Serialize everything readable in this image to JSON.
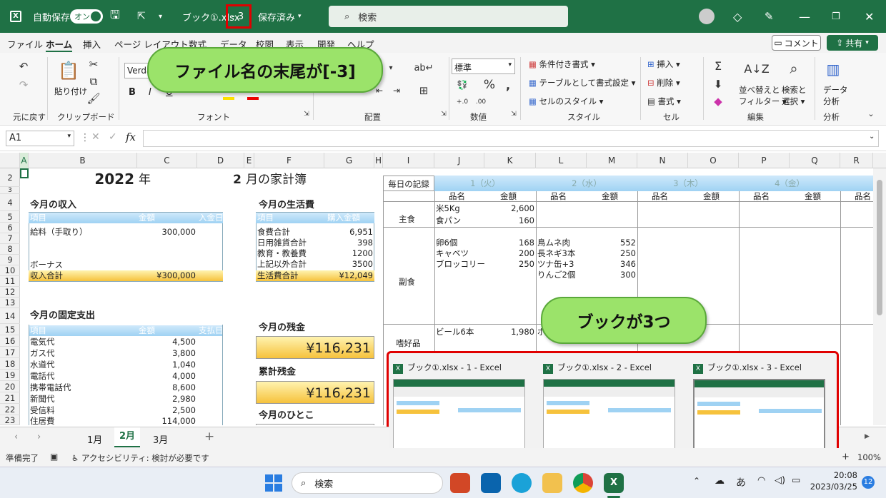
{
  "titlebar": {
    "autosave_label": "自動保存",
    "autosave_state": "オン",
    "filename": "ブック①.xlsx",
    "suffix": "- 3",
    "save_state": "保存済み",
    "search_placeholder": "検索"
  },
  "menu": [
    "ファイル",
    "ホーム",
    "挿入",
    "ページ レイアウト",
    "数式",
    "データ",
    "校閲",
    "表示",
    "開発",
    "ヘルプ"
  ],
  "menu_right": {
    "comment": "コメント",
    "share": "共有"
  },
  "ribbon": {
    "undo_label": "元に戻す",
    "paste_label": "貼り付け",
    "clipboard_label": "クリップボード",
    "font_name": "Verda",
    "font_label": "フォント",
    "align_label": "配置",
    "number_format": "標準",
    "number_label": "数値",
    "style_items": [
      "条件付き書式",
      "テーブルとして書式設定",
      "セルのスタイル"
    ],
    "style_label": "スタイル",
    "cell_items": [
      "挿入",
      "削除",
      "書式"
    ],
    "cell_label": "セル",
    "edit_sort": "並べ替えと",
    "edit_filter": "フィルター",
    "edit_find": "検索と",
    "edit_select": "選択",
    "edit_label": "編集",
    "analysis_text1": "データ",
    "analysis_text2": "分析",
    "analysis_label": "分析"
  },
  "formula": {
    "namebox": "A1",
    "fx": "fx"
  },
  "columns": [
    "A",
    "B",
    "C",
    "D",
    "E",
    "F",
    "G",
    "H",
    "I",
    "J",
    "K",
    "L",
    "M",
    "N",
    "O",
    "P",
    "Q",
    "R"
  ],
  "rows": [
    "2",
    "3",
    "4",
    "5",
    "6",
    "7",
    "8",
    "9",
    "10",
    "11",
    "12",
    "13",
    "14",
    "15",
    "16",
    "17",
    "18",
    "19",
    "20",
    "21",
    "22",
    "23"
  ],
  "sheet": {
    "year": "2022",
    "year_unit": "年",
    "month": "2",
    "month_title": "月の家計簿",
    "income_title": "今月の収入",
    "income_headers": [
      "項目",
      "金額",
      "入金日"
    ],
    "income_rows": [
      {
        "item": "給料（手取り）",
        "amount": "300,000"
      },
      {
        "item": "",
        "amount": ""
      },
      {
        "item": "",
        "amount": ""
      },
      {
        "item": "ボーナス",
        "amount": ""
      }
    ],
    "income_total_label": "収入合計",
    "income_total": "¥300,000",
    "living_title": "今月の生活費",
    "living_headers": [
      "項目",
      "購入金額"
    ],
    "living_rows": [
      {
        "item": "食費合計",
        "amount": "6,951"
      },
      {
        "item": "日用雑貨合計",
        "amount": "398"
      },
      {
        "item": "教育・教養費",
        "amount": "1200"
      },
      {
        "item": "上記以外合計",
        "amount": "3500"
      }
    ],
    "living_total_label": "生活費合計",
    "living_total": "¥12,049",
    "fixed_title": "今月の固定支出",
    "fixed_headers": [
      "項目",
      "金額",
      "支払日"
    ],
    "fixed_rows": [
      {
        "item": "電気代",
        "amount": "4,500"
      },
      {
        "item": "ガス代",
        "amount": "3,800"
      },
      {
        "item": "水道代",
        "amount": "1,040"
      },
      {
        "item": "電話代",
        "amount": "4,000"
      },
      {
        "item": "携帯電話代",
        "amount": "8,600"
      },
      {
        "item": "新聞代",
        "amount": "2,980"
      },
      {
        "item": "受信料",
        "amount": "2,500"
      },
      {
        "item": "住居費",
        "amount": "114,000"
      }
    ],
    "balance_title": "今月の残金",
    "balance": "¥116,231",
    "cumulative_title": "累計残金",
    "cumulative": "¥116,231",
    "comment_title": "今月のひとこ",
    "daily_title": "毎日の記録",
    "days": [
      "1（火）",
      "2（水）",
      "3（木）",
      "4（金）"
    ],
    "daily_sub": [
      "品名",
      "金額"
    ],
    "categories": [
      "主食",
      "副食",
      "嗜好品"
    ],
    "day1_staple": [
      {
        "name": "米5Kg",
        "amount": "2,600"
      },
      {
        "name": "食パン",
        "amount": "160"
      }
    ],
    "day1_side": [
      {
        "name": "卵6個",
        "amount": "168"
      },
      {
        "name": "キャベツ",
        "amount": "200"
      },
      {
        "name": "ブロッコリー",
        "amount": "250"
      }
    ],
    "day2_side": [
      {
        "name": "鳥ムネ肉",
        "amount": "552"
      },
      {
        "name": "長ネギ3本",
        "amount": "250"
      },
      {
        "name": "ツナ缶+3",
        "amount": "346"
      },
      {
        "name": "りんご2個",
        "amount": "300"
      }
    ],
    "day1_luxury": {
      "name": "ビール6本",
      "amount": "1,980"
    },
    "day2_luxury_partial": "ボ"
  },
  "callouts": {
    "filename": "ファイル名の末尾が[-3]",
    "books": "ブックが3つ"
  },
  "preview": [
    "ブック①.xlsx  -  1 - Excel",
    "ブック①.xlsx  -  2 - Excel",
    "ブック①.xlsx  -  3 - Excel"
  ],
  "tabs": [
    "1月",
    "2月",
    "3月"
  ],
  "status": {
    "ready": "準備完了",
    "accessibility": "アクセシビリティ: 検討が必要です",
    "zoom": "100%"
  },
  "taskbar": {
    "search": "検索",
    "ime": "あ",
    "time": "20:08",
    "date": "2023/03/25",
    "badge": "12"
  },
  "colors": {
    "excel_green": "#1f7145",
    "highlight_red": "#e00000",
    "callout_green": "#9be36a"
  }
}
